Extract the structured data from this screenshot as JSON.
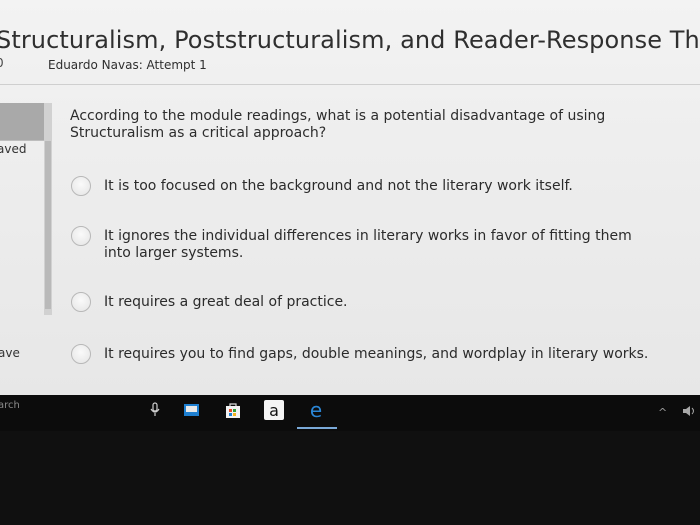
{
  "header": {
    "title": "Structuralism, Poststructuralism, and Reader-Response Theory",
    "score_prefix": "0",
    "attempt": "Eduardo Navas: Attempt 1"
  },
  "sidebar": {
    "saved_label": "aved",
    "save_label": "ave"
  },
  "question": {
    "text": "According to the module readings, what is a potential disadvantage of using Structuralism as a critical approach?",
    "options": [
      "It is too focused on the background and not the literary work itself.",
      "It ignores the individual differences in literary works in favor of fitting them into larger systems.",
      "It requires a great deal of practice.",
      "It requires you to find gaps, double meanings, and wordplay in literary works."
    ]
  },
  "taskbar": {
    "search_label": "arch",
    "icons": [
      "microphone-icon",
      "tablet-icon",
      "store-icon",
      "amazon-icon",
      "edge-icon"
    ],
    "amazon_glyph": "a",
    "edge_glyph": "e",
    "tray_chevron": "^",
    "colors": {
      "edge": "#2b86d6",
      "taskbar": "#0c0c0c"
    }
  }
}
